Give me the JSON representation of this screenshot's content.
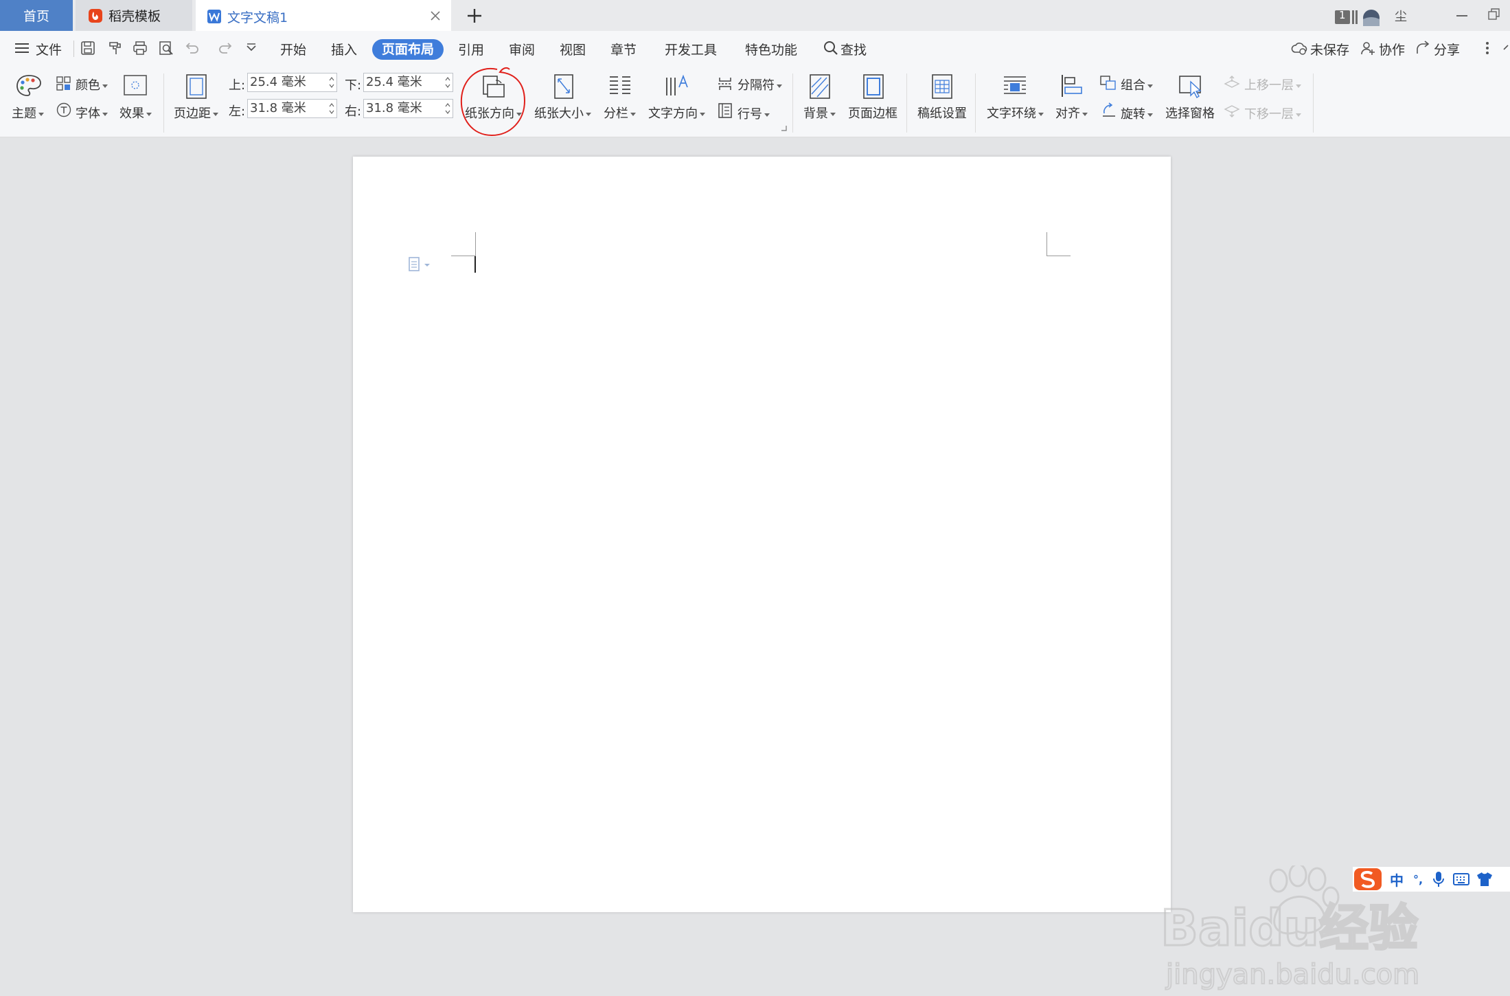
{
  "tabs": {
    "home": "首页",
    "template": "稻壳模板",
    "document": "文字文稿1"
  },
  "titlebar": {
    "badge": "1",
    "user": "尘"
  },
  "menu": {
    "file": "文件",
    "items": [
      "开始",
      "插入",
      "页面布局",
      "引用",
      "审阅",
      "视图",
      "章节",
      "开发工具",
      "特色功能"
    ],
    "active": "页面布局",
    "search": "查找",
    "unsaved": "未保存",
    "collab": "协作",
    "share": "分享"
  },
  "ribbon": {
    "theme": "主题",
    "color": "颜色",
    "font": "字体",
    "effect": "效果",
    "margins": "页边距",
    "top_label": "上:",
    "top_value": "25.4 毫米",
    "bottom_label": "下:",
    "bottom_value": "25.4 毫米",
    "left_label": "左:",
    "left_value": "31.8 毫米",
    "right_label": "右:",
    "right_value": "31.8 毫米",
    "orientation": "纸张方向",
    "size": "纸张大小",
    "columns": "分栏",
    "text_direction": "文字方向",
    "breaks": "分隔符",
    "line_numbers": "行号",
    "background": "背景",
    "page_border": "页面边框",
    "manuscript": "稿纸设置",
    "wrap": "文字环绕",
    "align": "对齐",
    "group": "组合",
    "rotate": "旋转",
    "selection_pane": "选择窗格",
    "bring_forward": "上移一层",
    "send_backward": "下移一层"
  },
  "watermark": {
    "brand": "Baidu经验",
    "url": "jingyan.baidu.com"
  },
  "ime": {
    "lang": "中",
    "punct": "°,"
  },
  "colors": {
    "accent": "#3f7ddb",
    "home_tab": "#4f81c7",
    "annotation": "#e0201b",
    "ime_logo": "#f15a22"
  }
}
